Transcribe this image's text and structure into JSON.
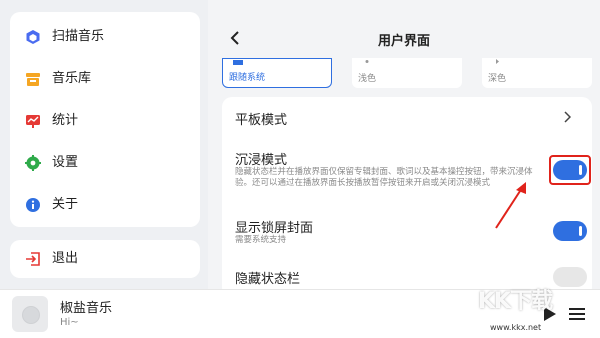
{
  "sidebar": {
    "items": [
      {
        "label": "扫描音乐",
        "icon": "scan-cube-icon"
      },
      {
        "label": "音乐库",
        "icon": "library-icon"
      },
      {
        "label": "统计",
        "icon": "stats-icon"
      },
      {
        "label": "设置",
        "icon": "gear-icon"
      },
      {
        "label": "关于",
        "icon": "info-icon"
      }
    ],
    "exit": {
      "label": "退出",
      "icon": "exit-icon"
    }
  },
  "player": {
    "title": "椒盐音乐",
    "subtitle": "Hi~"
  },
  "header": {
    "title": "用户界面"
  },
  "themes": [
    {
      "label": "跟随系统",
      "selected": true
    },
    {
      "label": "浅色",
      "selected": false
    },
    {
      "label": "深色",
      "selected": false
    }
  ],
  "settings": {
    "tablet_mode": {
      "title": "平板模式"
    },
    "immersive": {
      "title": "沉浸模式",
      "desc": "隐藏状态栏并在播放界面仅保留专辑封面、歌词以及基本操控按钮，带来沉浸体验。还可以通过在播放界面长按播放暂停按钮来开启或关闭沉浸模式",
      "enabled": true
    },
    "lockscreen": {
      "title": "显示锁屏封面",
      "desc": "需要系统支持",
      "enabled": true
    },
    "hide_statusbar": {
      "title": "隐藏状态栏",
      "enabled": false
    }
  },
  "colors": {
    "accent": "#2f6fe0",
    "annotation": "#e0231b"
  },
  "watermark": {
    "logo": "KK下载",
    "url": "www.kkx.net"
  }
}
